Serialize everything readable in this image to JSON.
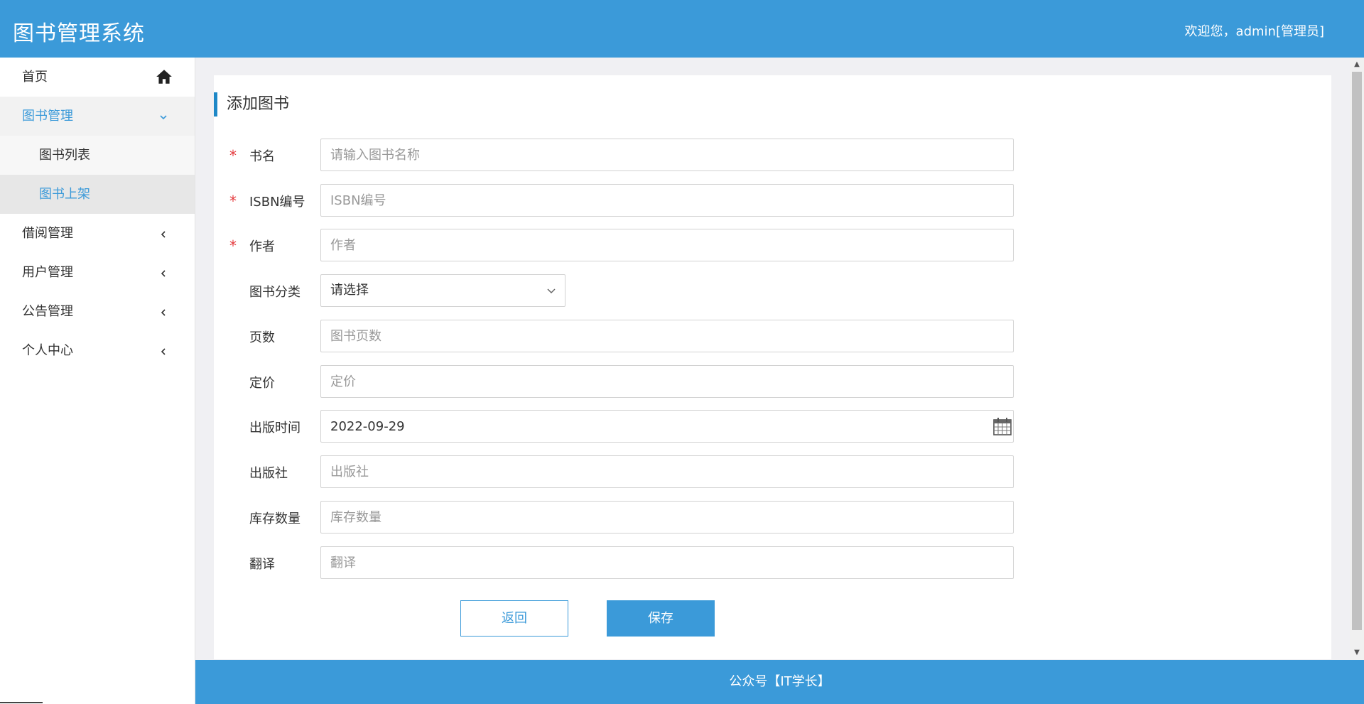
{
  "header": {
    "app_title": "图书管理系统",
    "welcome": "欢迎您，admin[管理员]"
  },
  "sidebar": {
    "items": [
      {
        "label": "首页",
        "icon": "home-icon"
      },
      {
        "label": "图书管理",
        "icon": "chevron-down-icon",
        "expanded": true
      },
      {
        "label": "图书列表"
      },
      {
        "label": "图书上架",
        "selected": true
      },
      {
        "label": "借阅管理",
        "icon": "chevron-left-icon"
      },
      {
        "label": "用户管理",
        "icon": "chevron-left-icon"
      },
      {
        "label": "公告管理",
        "icon": "chevron-left-icon"
      },
      {
        "label": "个人中心",
        "icon": "chevron-left-icon"
      }
    ]
  },
  "panel": {
    "title": "添加图书"
  },
  "form": {
    "fields": [
      {
        "label": "书名",
        "required": true,
        "placeholder": "请输入图书名称",
        "value": ""
      },
      {
        "label": "ISBN编号",
        "required": true,
        "placeholder": "ISBN编号",
        "value": ""
      },
      {
        "label": "作者",
        "required": true,
        "placeholder": "作者",
        "value": ""
      },
      {
        "label": "图书分类",
        "required": false,
        "selected": "请选择"
      },
      {
        "label": "页数",
        "required": false,
        "placeholder": "图书页数",
        "value": ""
      },
      {
        "label": "定价",
        "required": false,
        "placeholder": "定价",
        "value": ""
      },
      {
        "label": "出版时间",
        "required": false,
        "placeholder": "",
        "value": "2022-09-29"
      },
      {
        "label": "出版社",
        "required": false,
        "placeholder": "出版社",
        "value": ""
      },
      {
        "label": "库存数量",
        "required": false,
        "placeholder": "库存数量",
        "value": ""
      },
      {
        "label": "翻译",
        "required": false,
        "placeholder": "翻译",
        "value": ""
      }
    ],
    "required_mark": "*",
    "back_label": "返回",
    "save_label": "保存"
  },
  "footer": {
    "text": "公众号【IT学长】"
  },
  "colors": {
    "primary": "#3b9ad9",
    "required": "#e4393c"
  }
}
